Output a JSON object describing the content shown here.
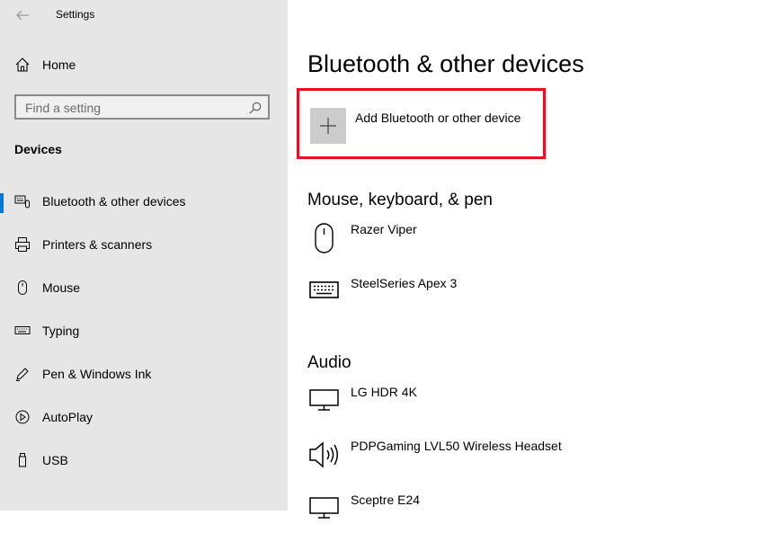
{
  "window": {
    "title": "Settings"
  },
  "sidebar": {
    "home_label": "Home",
    "search_placeholder": "Find a setting",
    "section_title": "Devices",
    "items": [
      {
        "label": "Bluetooth & other devices",
        "icon": "bluetooth-devices-icon",
        "active": true
      },
      {
        "label": "Printers & scanners",
        "icon": "printer-icon",
        "active": false
      },
      {
        "label": "Mouse",
        "icon": "mouse-icon",
        "active": false
      },
      {
        "label": "Typing",
        "icon": "keyboard-icon",
        "active": false
      },
      {
        "label": "Pen & Windows Ink",
        "icon": "pen-icon",
        "active": false
      },
      {
        "label": "AutoPlay",
        "icon": "autoplay-icon",
        "active": false
      },
      {
        "label": "USB",
        "icon": "usb-icon",
        "active": false
      }
    ]
  },
  "main": {
    "title": "Bluetooth & other devices",
    "add_device_label": "Add Bluetooth or other device",
    "groups": [
      {
        "heading": "Mouse, keyboard, & pen",
        "devices": [
          {
            "name": "Razer Viper",
            "icon": "mouse-icon"
          },
          {
            "name": "SteelSeries Apex 3",
            "icon": "keyboard-icon"
          }
        ]
      },
      {
        "heading": "Audio",
        "devices": [
          {
            "name": "LG HDR 4K",
            "icon": "monitor-icon"
          },
          {
            "name": "PDPGaming LVL50 Wireless Headset",
            "icon": "speaker-icon"
          },
          {
            "name": "Sceptre E24",
            "icon": "monitor-icon"
          }
        ]
      }
    ]
  },
  "colors": {
    "accent": "#0078d7",
    "highlight_box": "#e81123",
    "sidebar_bg": "#e6e6e6"
  }
}
